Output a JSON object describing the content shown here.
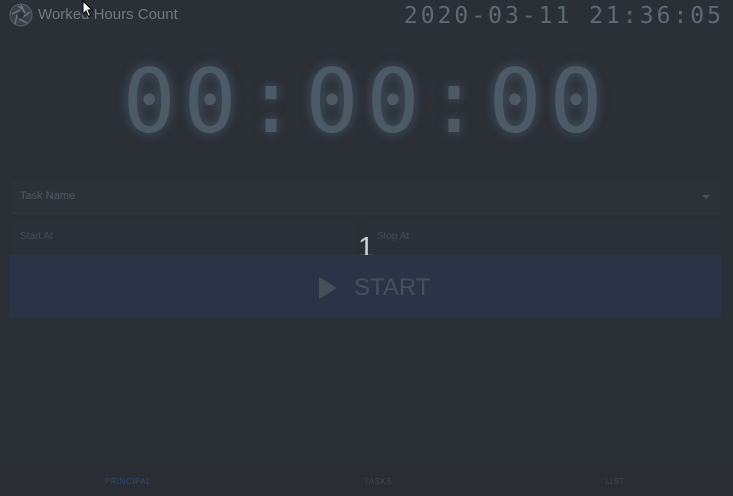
{
  "app": {
    "title": "Worked Hours Count",
    "datetime": "2020-03-11 21:36:05"
  },
  "timer": {
    "display": "00:00:00"
  },
  "form": {
    "task_name_label": "Task Name",
    "start_at_label": "Start At",
    "stop_at_label": "Stop At"
  },
  "countdown": "1",
  "start_button": {
    "label": "START"
  },
  "nav": {
    "items": [
      {
        "label": "PRINCIPAL",
        "active": true
      },
      {
        "label": "TASKS",
        "active": false
      },
      {
        "label": "LIST",
        "active": false
      }
    ]
  },
  "colors": {
    "background": "#2b2f36",
    "accent": "#2e4a78",
    "button_bg": "#2a3446"
  },
  "icons": {
    "logo": "aperture-logo-icon",
    "start": "play-icon",
    "dropdown": "caret-down-icon"
  }
}
